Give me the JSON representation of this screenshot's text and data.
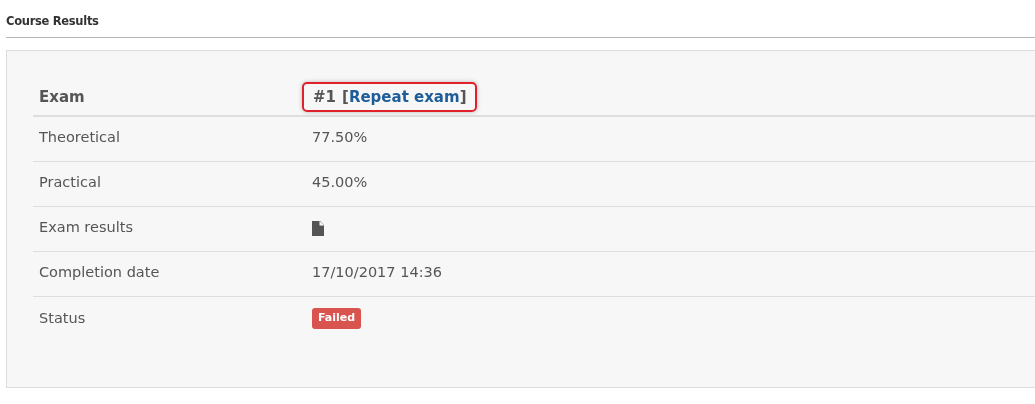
{
  "section_title": "Course Results",
  "header": {
    "label": "Exam",
    "number": "#1",
    "bracket_open": "[",
    "link": "Repeat exam",
    "bracket_close": "]",
    "highlighted": true
  },
  "rows": [
    {
      "kind": "text",
      "label": "Theoretical",
      "value": "77.50%"
    },
    {
      "kind": "text",
      "label": "Practical",
      "value": "45.00%"
    },
    {
      "kind": "icon",
      "label": "Exam results"
    },
    {
      "kind": "text",
      "label": "Completion date",
      "value": "17/10/2017 14:36"
    },
    {
      "kind": "badge",
      "label": "Status",
      "value": "Failed",
      "color": "#d9534f"
    }
  ]
}
